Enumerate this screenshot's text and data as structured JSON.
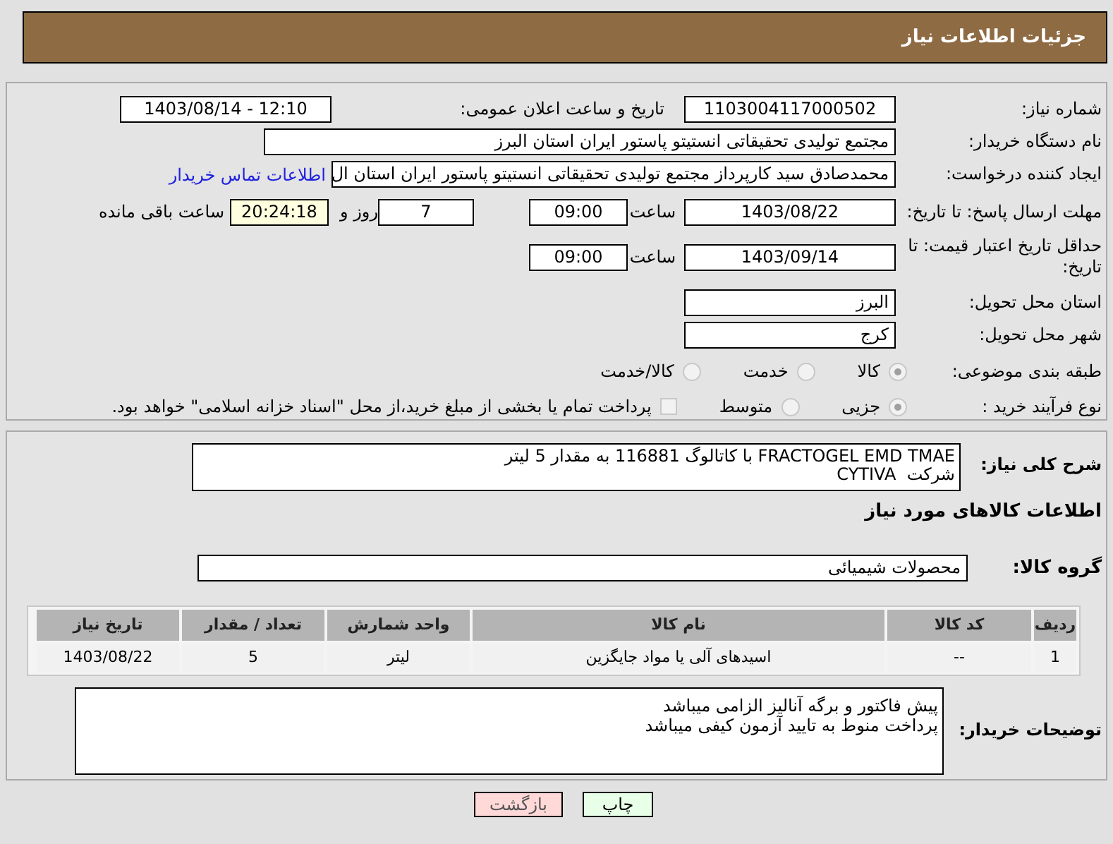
{
  "header": {
    "title": "جزئیات اطلاعات نیاز"
  },
  "need_number": {
    "label": "شماره نیاز:",
    "value": "1103004117000502"
  },
  "announce": {
    "label": "تاریخ و ساعت اعلان عمومی:",
    "value": "1403/08/14 - 12:10"
  },
  "buyer_org": {
    "label": "نام دستگاه خریدار:",
    "value": "مجتمع تولیدی تحقیقاتی انستیتو پاستور ایران استان البرز"
  },
  "requester": {
    "label": "ایجاد کننده درخواست:",
    "value": "محمدصادق سید کارپرداز مجتمع تولیدی تحقیقاتی انستیتو پاستور ایران استان ال",
    "link": "اطلاعات تماس خریدار"
  },
  "deadline": {
    "label": "مهلت ارسال پاسخ: تا تاریخ:",
    "date": "1403/08/22",
    "time_label": "ساعت",
    "time": "09:00",
    "days": "7",
    "days_label": "روز و",
    "remaining": "20:24:18",
    "remaining_label": "ساعت باقی مانده"
  },
  "validity": {
    "label": "حداقل تاریخ اعتبار قیمت: تا تاریخ:",
    "date": "1403/09/14",
    "time_label": "ساعت",
    "time": "09:00"
  },
  "province": {
    "label": "استان محل تحویل:",
    "value": "البرز"
  },
  "city": {
    "label": "شهر محل تحویل:",
    "value": "کرج"
  },
  "category": {
    "label": "طبقه بندی موضوعی:",
    "options": [
      {
        "label": "کالا",
        "selected": true
      },
      {
        "label": "خدمت",
        "selected": false
      },
      {
        "label": "کالا/خدمت",
        "selected": false
      }
    ]
  },
  "process": {
    "label": "نوع فرآیند خرید :",
    "options": [
      {
        "label": "جزیی",
        "selected": true
      },
      {
        "label": "متوسط",
        "selected": false
      }
    ],
    "payment": {
      "label": "پرداخت تمام یا بخشی از مبلغ خرید،از محل \"اسناد خزانه اسلامی\" خواهد بود.",
      "checked": false
    }
  },
  "description": {
    "label": "شرح کلی نیاز:",
    "lines": [
      "FRACTOGEL EMD TMAE با کاتالوگ 116881 به مقدار 5 لیتر",
      "شرکت  CYTIVA"
    ]
  },
  "goods_heading": "اطلاعات کالاهای مورد نیاز",
  "goods_group": {
    "label": "گروه کالا:",
    "value": "محصولات شیمیائی"
  },
  "table": {
    "columns": [
      "ردیف",
      "کد کالا",
      "نام کالا",
      "واحد شمارش",
      "تعداد / مقدار",
      "تاریخ نیاز"
    ],
    "rows": [
      [
        "1",
        "--",
        "اسیدهای آلی یا مواد جایگزین",
        "لیتر",
        "5",
        "1403/08/22"
      ]
    ]
  },
  "buyer_notes": {
    "label": "توضیحات خریدار:",
    "lines": [
      "پیش فاکتور و برگه آنالیز الزامی میباشد",
      "پرداخت منوط به تایید آزمون کیفی میباشد"
    ]
  },
  "buttons": [
    {
      "label": "چاپ",
      "kind": "print"
    },
    {
      "label": "بازگشت",
      "kind": "back"
    }
  ]
}
